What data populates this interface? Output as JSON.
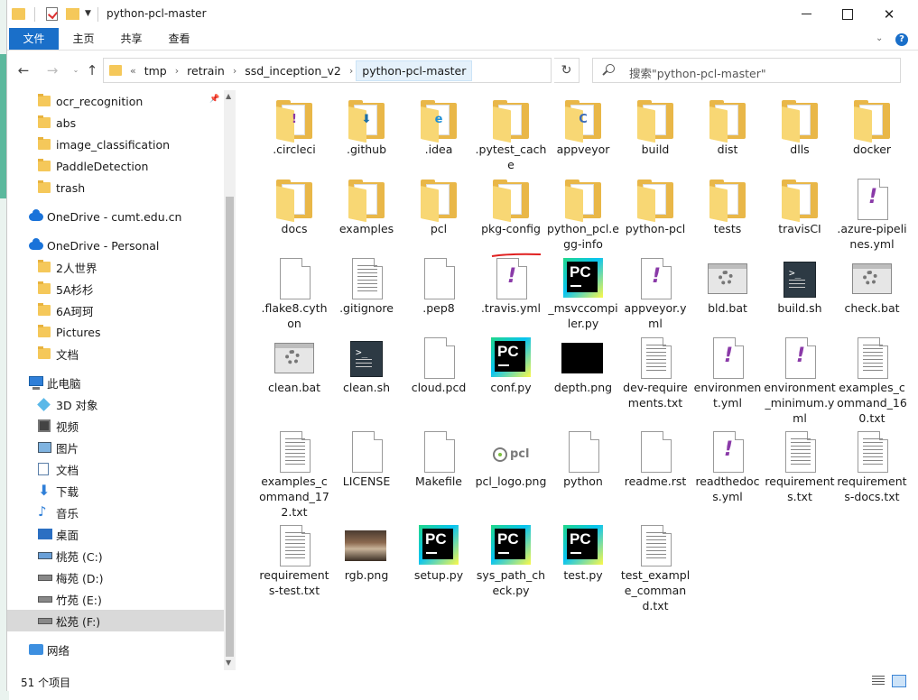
{
  "window": {
    "title": "python-pcl-master"
  },
  "ribbon": {
    "tabs": [
      "文件",
      "主页",
      "共享",
      "查看"
    ]
  },
  "address": {
    "breadcrumbs": [
      "tmp",
      "retrain",
      "ssd_inception_v2",
      "python-pcl-master"
    ],
    "overflow": "«"
  },
  "search": {
    "placeholder": "搜索\"python-pcl-master\""
  },
  "sidebar": {
    "items": [
      {
        "label": "ocr_recognition",
        "icon": "folder-icon",
        "pinned": true
      },
      {
        "label": "abs",
        "icon": "folder-icon"
      },
      {
        "label": "image_classification",
        "icon": "folder-icon"
      },
      {
        "label": "PaddleDetection",
        "icon": "folder-icon"
      },
      {
        "label": "trash",
        "icon": "folder-icon"
      },
      {
        "label": "OneDrive - cumt.edu.cn",
        "icon": "onedrive-icon"
      },
      {
        "label": "OneDrive - Personal",
        "icon": "onedrive-icon"
      },
      {
        "label": "2人世界",
        "icon": "folder-icon"
      },
      {
        "label": "5A杉杉",
        "icon": "folder-icon"
      },
      {
        "label": "6A珂珂",
        "icon": "folder-icon"
      },
      {
        "label": "Pictures",
        "icon": "folder-icon"
      },
      {
        "label": "文档",
        "icon": "folder-icon"
      },
      {
        "label": "此电脑",
        "icon": "this-pc-icon"
      },
      {
        "label": "3D 对象",
        "icon": "3d-objects-icon"
      },
      {
        "label": "视频",
        "icon": "videos-icon"
      },
      {
        "label": "图片",
        "icon": "pictures-icon"
      },
      {
        "label": "文档",
        "icon": "documents-icon"
      },
      {
        "label": "下载",
        "icon": "downloads-icon"
      },
      {
        "label": "音乐",
        "icon": "music-icon"
      },
      {
        "label": "桌面",
        "icon": "desktop-icon"
      },
      {
        "label": "桃苑 (C:)",
        "icon": "system-drive-icon"
      },
      {
        "label": "梅苑 (D:)",
        "icon": "drive-icon"
      },
      {
        "label": "竹苑 (E:)",
        "icon": "drive-icon"
      },
      {
        "label": "松苑 (F:)",
        "icon": "drive-icon",
        "selected": true
      },
      {
        "label": "网络",
        "icon": "network-icon"
      }
    ]
  },
  "files": [
    {
      "name": ".circleci",
      "icon": "folder-purple-icon"
    },
    {
      "name": ".github",
      "icon": "folder-github-icon"
    },
    {
      "name": ".idea",
      "icon": "folder-ie-icon"
    },
    {
      "name": ".pytest_cache",
      "icon": "folder-icon"
    },
    {
      "name": "appveyor",
      "icon": "folder-c-icon"
    },
    {
      "name": "build",
      "icon": "folder-icon"
    },
    {
      "name": "dist",
      "icon": "folder-icon"
    },
    {
      "name": "dlls",
      "icon": "folder-icon"
    },
    {
      "name": "docker",
      "icon": "folder-icon"
    },
    {
      "name": "docs",
      "icon": "folder-icon"
    },
    {
      "name": "examples",
      "icon": "folder-icon"
    },
    {
      "name": "pcl",
      "icon": "folder-icon"
    },
    {
      "name": "pkg-config",
      "icon": "folder-icon"
    },
    {
      "name": "python_pcl.egg-info",
      "icon": "folder-icon"
    },
    {
      "name": "python-pcl",
      "icon": "folder-icon"
    },
    {
      "name": "tests",
      "icon": "folder-icon"
    },
    {
      "name": "travisCI",
      "icon": "folder-icon"
    },
    {
      "name": ".azure-pipelines.yml",
      "icon": "yml-file-icon"
    },
    {
      "name": ".flake8.cython",
      "icon": "blank-file-icon"
    },
    {
      "name": ".gitignore",
      "icon": "text-file-icon"
    },
    {
      "name": ".pep8",
      "icon": "blank-file-icon"
    },
    {
      "name": ".travis.yml",
      "icon": "yml-file-icon"
    },
    {
      "name": "_msvccompiler.py",
      "icon": "pycharm-icon"
    },
    {
      "name": "appveyor.yml",
      "icon": "yml-file-icon"
    },
    {
      "name": "bld.bat",
      "icon": "batch-file-icon"
    },
    {
      "name": "build.sh",
      "icon": "shell-script-icon"
    },
    {
      "name": "check.bat",
      "icon": "batch-file-icon"
    },
    {
      "name": "clean.bat",
      "icon": "batch-file-icon"
    },
    {
      "name": "clean.sh",
      "icon": "shell-script-icon"
    },
    {
      "name": "cloud.pcd",
      "icon": "blank-file-icon"
    },
    {
      "name": "conf.py",
      "icon": "pycharm-icon"
    },
    {
      "name": "depth.png",
      "icon": "black-image-thumbnail"
    },
    {
      "name": "dev-requirements.txt",
      "icon": "text-file-icon"
    },
    {
      "name": "environment.yml",
      "icon": "yml-file-icon"
    },
    {
      "name": "environment_minimum.yml",
      "icon": "yml-file-icon"
    },
    {
      "name": "examples_command_160.txt",
      "icon": "text-file-icon"
    },
    {
      "name": "examples_command_172.txt",
      "icon": "text-file-icon"
    },
    {
      "name": "LICENSE",
      "icon": "blank-file-icon"
    },
    {
      "name": "Makefile",
      "icon": "blank-file-icon"
    },
    {
      "name": "pcl_logo.png",
      "icon": "pcl-logo-thumbnail"
    },
    {
      "name": "python",
      "icon": "blank-file-icon"
    },
    {
      "name": "readme.rst",
      "icon": "blank-file-icon"
    },
    {
      "name": "readthedocs.yml",
      "icon": "yml-file-icon"
    },
    {
      "name": "requirements.txt",
      "icon": "text-file-icon"
    },
    {
      "name": "requirements-docs.txt",
      "icon": "text-file-icon"
    },
    {
      "name": "requirements-test.txt",
      "icon": "text-file-icon"
    },
    {
      "name": "rgb.png",
      "icon": "photo-thumbnail"
    },
    {
      "name": "setup.py",
      "icon": "pycharm-icon"
    },
    {
      "name": "sys_path_check.py",
      "icon": "pycharm-icon"
    },
    {
      "name": "test.py",
      "icon": "pycharm-icon"
    },
    {
      "name": "test_example_command.txt",
      "icon": "text-file-icon"
    }
  ],
  "status": {
    "item_count": "51 个项目"
  },
  "colors": {
    "accent": "#1a6fc9",
    "annotation": "#e02020"
  }
}
